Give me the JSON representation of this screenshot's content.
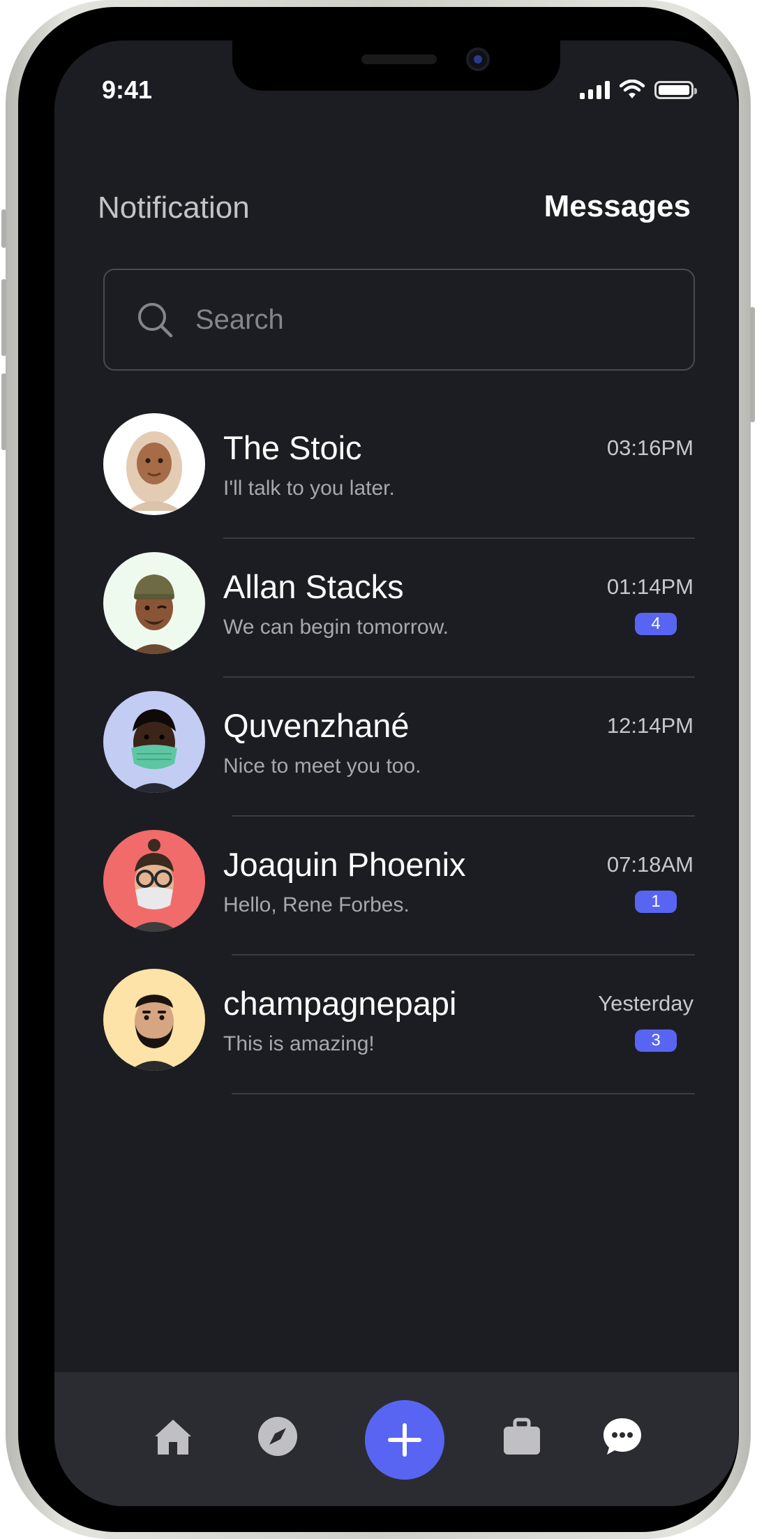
{
  "status_bar": {
    "time": "9:41"
  },
  "header": {
    "notification_tab": "Notification",
    "messages_tab": "Messages"
  },
  "search": {
    "placeholder": "Search",
    "value": ""
  },
  "conversations": [
    {
      "name": "The Stoic",
      "message": "I'll talk to you later.",
      "time": "03:16PM",
      "unread": null,
      "avatar_bg": "#ffffff"
    },
    {
      "name": "Allan Stacks",
      "message": "We can begin tomorrow.",
      "time": "01:14PM",
      "unread": "4",
      "avatar_bg": "#eefaee"
    },
    {
      "name": "Quvenzhané",
      "message": "Nice to meet you too.",
      "time": "12:14PM",
      "unread": null,
      "avatar_bg": "#c3cdf3"
    },
    {
      "name": "Joaquin Phoenix",
      "message": "Hello, Rene Forbes.",
      "time": "07:18AM",
      "unread": "1",
      "avatar_bg": "#f16b6b"
    },
    {
      "name": "champagnepapi",
      "message": "This is amazing!",
      "time": "Yesterday",
      "unread": "3",
      "avatar_bg": "#fde3a7"
    }
  ],
  "bottom_nav": [
    {
      "icon": "home-icon"
    },
    {
      "icon": "compass-icon"
    },
    {
      "icon": "plus-icon"
    },
    {
      "icon": "briefcase-icon"
    },
    {
      "icon": "chat-bubble-icon"
    }
  ],
  "colors": {
    "background": "#1c1d22",
    "accent": "#5865f2",
    "nav_background": "#2b2c31",
    "divider": "#3c3d43"
  }
}
